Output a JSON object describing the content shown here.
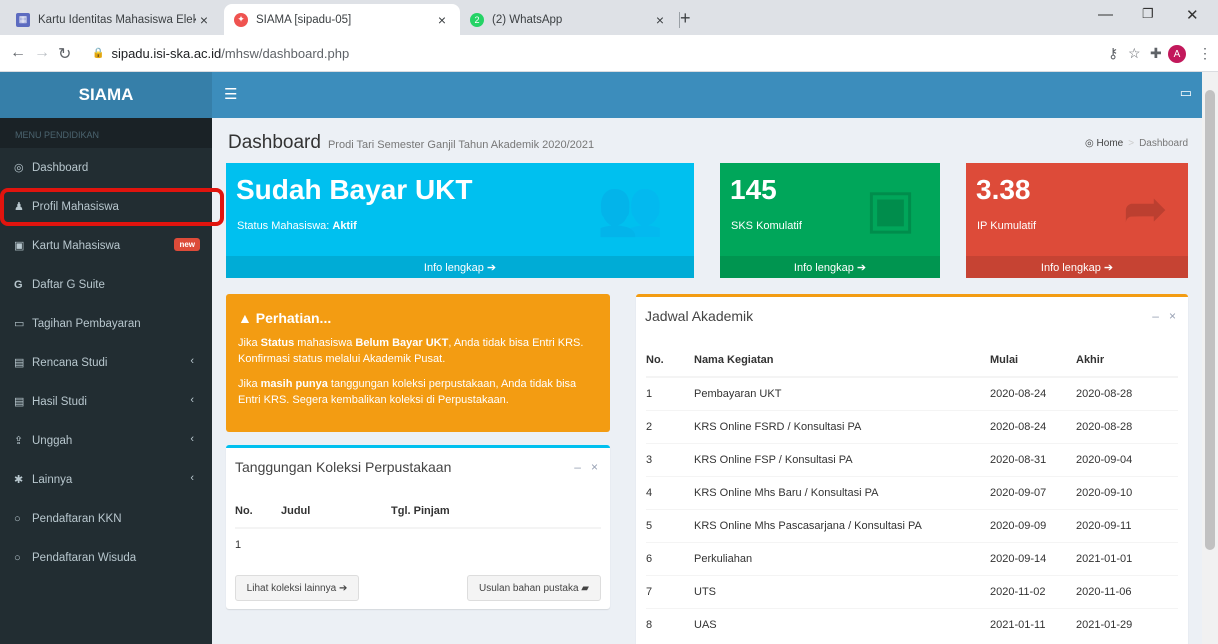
{
  "browser": {
    "tabs": [
      {
        "title": "Kartu Identitas Mahasiswa Elektro",
        "icon": "table-icon",
        "color": "#5c6bc0"
      },
      {
        "title": "SIAMA [sipadu-05]",
        "icon": "siama-icon",
        "color": "#ef5350"
      },
      {
        "title": "(2) WhatsApp",
        "icon": "whatsapp-icon",
        "color": "#25d366",
        "badge": "2"
      }
    ],
    "url_host": "sipadu.isi-ska.ac.id",
    "url_path": "/mhsw/dashboard.php",
    "avatar": "A"
  },
  "app": {
    "brand": "SIAMA"
  },
  "sidebar": {
    "header": "MENU PENDIDIKAN",
    "items": [
      {
        "label": "Dashboard",
        "icon": "dashboard-icon",
        "glyph": "◎"
      },
      {
        "label": "Profil Mahasiswa",
        "icon": "user-icon",
        "glyph": "♟"
      },
      {
        "label": "Kartu Mahasiswa",
        "icon": "id-card-icon",
        "glyph": "▣",
        "badge": "new"
      },
      {
        "label": "Daftar G Suite",
        "icon": "google-icon",
        "glyph": "G"
      },
      {
        "label": "Tagihan Pembayaran",
        "icon": "money-icon",
        "glyph": "▭"
      },
      {
        "label": "Rencana Studi",
        "icon": "file-icon",
        "glyph": "▤",
        "caret": "‹"
      },
      {
        "label": "Hasil Studi",
        "icon": "file-icon",
        "glyph": "▤",
        "caret": "‹"
      },
      {
        "label": "Unggah",
        "icon": "upload-icon",
        "glyph": "⇪",
        "caret": "‹"
      },
      {
        "label": "Lainnya",
        "icon": "gear-icon",
        "glyph": "✱",
        "caret": "‹"
      },
      {
        "label": "Pendaftaran KKN",
        "icon": "circle-icon",
        "glyph": "○"
      },
      {
        "label": "Pendaftaran Wisuda",
        "icon": "circle-icon",
        "glyph": "○"
      }
    ]
  },
  "header": {
    "title": "Dashboard",
    "subtitle": "Prodi Tari Semester Ganjil Tahun Akademik 2020/2021",
    "crumb_home": "Home",
    "crumb_current": "Dashboard"
  },
  "stats": [
    {
      "big": "Sudah Bayar UKT",
      "sub_prefix": "Status Mahasiswa: ",
      "sub_bold": "Aktif",
      "foot": "Info lengkap ➔",
      "color": "#00c0ef",
      "icon": "users-icon"
    },
    {
      "big": "145",
      "sub_prefix": "SKS Komulatif",
      "sub_bold": "",
      "foot": "Info lengkap ➔",
      "color": "#00a65a",
      "icon": "blackboard-icon"
    },
    {
      "big": "3.38",
      "sub_prefix": "IP Kumulatif",
      "sub_bold": "",
      "foot": "Info lengkap ➔",
      "color": "#dd4b39",
      "icon": "share-icon"
    }
  ],
  "callout": {
    "title": "Perhatian...",
    "p1a": "Jika ",
    "p1b": "Status",
    "p1c": " mahasiswa ",
    "p1d": "Belum Bayar UKT",
    "p1e": ", Anda tidak bisa Entri KRS. Konfirmasi status melalui Akademik Pusat.",
    "p2a": "Jika ",
    "p2b": "masih punya",
    "p2c": " tanggungan koleksi perpustakaan, Anda tidak bisa Entri KRS. Segera kembalikan koleksi di Perpustakaan."
  },
  "library": {
    "title": "Tanggungan Koleksi Perpustakaan",
    "headers": [
      "No.",
      "Judul",
      "Tgl. Pinjam"
    ],
    "rows": [
      [
        "1",
        "",
        ""
      ]
    ],
    "btn_more": "Lihat koleksi lainnya ➔",
    "btn_suggest": "Usulan bahan pustaka ▰"
  },
  "schedule": {
    "title": "Jadwal Akademik",
    "headers": [
      "No.",
      "Nama Kegiatan",
      "Mulai",
      "Akhir"
    ],
    "rows": [
      [
        "1",
        "Pembayaran UKT",
        "2020-08-24",
        "2020-08-28"
      ],
      [
        "2",
        "KRS Online FSRD / Konsultasi PA",
        "2020-08-24",
        "2020-08-28"
      ],
      [
        "3",
        "KRS Online FSP / Konsultasi PA",
        "2020-08-31",
        "2020-09-04"
      ],
      [
        "4",
        "KRS Online Mhs Baru / Konsultasi PA",
        "2020-09-07",
        "2020-09-10"
      ],
      [
        "5",
        "KRS Online Mhs Pascasarjana / Konsultasi PA",
        "2020-09-09",
        "2020-09-11"
      ],
      [
        "6",
        "Perkuliahan",
        "2020-09-14",
        "2021-01-01"
      ],
      [
        "7",
        "UTS",
        "2020-11-02",
        "2020-11-06"
      ],
      [
        "8",
        "UAS",
        "2021-01-11",
        "2021-01-29"
      ]
    ]
  }
}
